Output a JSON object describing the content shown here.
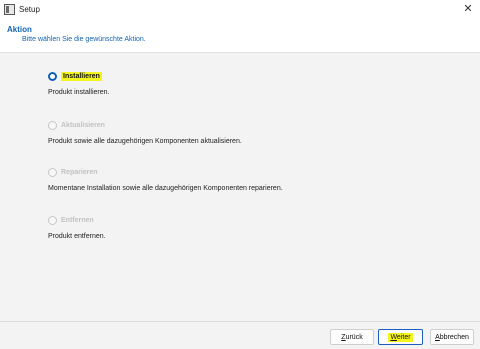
{
  "window": {
    "title": "Setup",
    "close_glyph": "✕"
  },
  "header": {
    "title": "Aktion",
    "subtitle": "Bitte wählen Sie die gewünschte Aktion."
  },
  "options": [
    {
      "label": "Installieren",
      "description": "Produkt installieren.",
      "selected": true,
      "enabled": true
    },
    {
      "label": "Aktualisieren",
      "description": "Produkt sowie alle dazugehörigen Komponenten aktualisieren.",
      "selected": false,
      "enabled": false
    },
    {
      "label": "Reparieren",
      "description": "Momentane Installation sowie alle dazugehörigen Komponenten reparieren.",
      "selected": false,
      "enabled": false
    },
    {
      "label": "Entfernen",
      "description": "Produkt entfernen.",
      "selected": false,
      "enabled": false
    }
  ],
  "buttons": {
    "back_first": "Z",
    "back_rest": "urück",
    "next_first": "W",
    "next_rest": "eiter",
    "cancel_first": "A",
    "cancel_rest": "bbrechen"
  },
  "colors": {
    "accent": "#1464b4",
    "highlight": "#f5f51e",
    "radio_selected": "#0f5fb5"
  }
}
